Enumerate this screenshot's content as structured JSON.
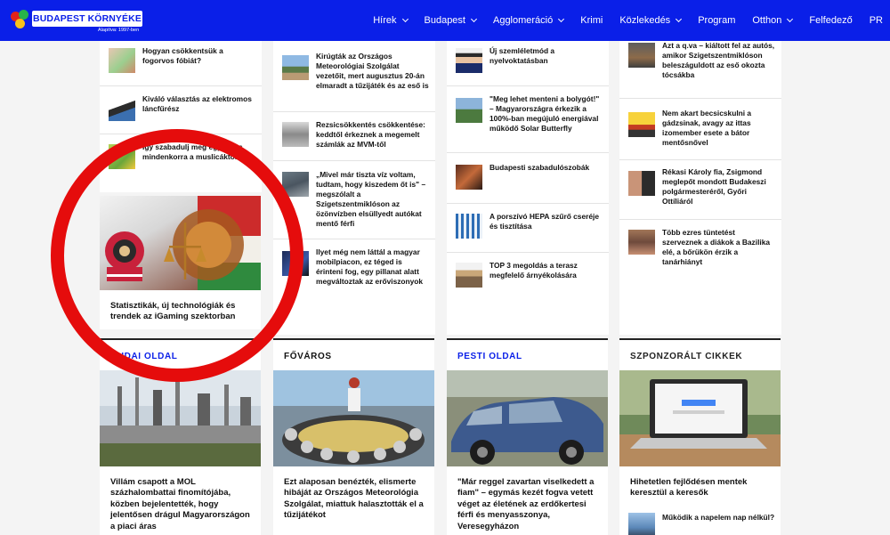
{
  "header": {
    "logo_text": "BUDAPEST KÖRNYÉKE",
    "logo_sub": "Alapítva: 1997-ben",
    "nav": [
      {
        "label": "Hírek",
        "dropdown": true
      },
      {
        "label": "Budapest",
        "dropdown": true
      },
      {
        "label": "Agglomeráció",
        "dropdown": true
      },
      {
        "label": "Krimi",
        "dropdown": false
      },
      {
        "label": "Közlekedés",
        "dropdown": true
      },
      {
        "label": "Program",
        "dropdown": false
      },
      {
        "label": "Otthon",
        "dropdown": true
      },
      {
        "label": "Felfedező",
        "dropdown": false
      },
      {
        "label": "PR",
        "dropdown": false
      }
    ]
  },
  "col1": {
    "items": [
      "Hogyan csökkentsük a fogorvos fóbiát?",
      "Kiváló választás az elektromos láncfűrész",
      "Így szabadulj meg egyszer s mindenkorra a muslicáktól..."
    ],
    "featured_title": "Statisztikák, új technológiák és trendek az iGaming szektorban"
  },
  "col2": {
    "items": [
      "Kirúgták az Országos Meteorológiai Szolgálat vezetőit, mert augusztus 20-án elmaradt a tűzijáték és az eső is",
      "Rezsicsökkentés csökkentése: keddtől érkeznek a megemelt számlák az MVM-től",
      "„Mivel már tiszta víz voltam, tudtam, hogy kiszedem őt is\" – megszólalt a Szigetszentmiklóson az özönvízben elsüllyedt autókat mentő férfi",
      "Ilyet még nem láttál a magyar mobilpiacon, ez téged is érinteni fog, egy pillanat alatt megváltoztak az erőviszonyok"
    ]
  },
  "col3": {
    "items": [
      "Új szemléletmód a nyelvoktatásban",
      "\"Meg lehet menteni a bolygót!\" – Magyarországra érkezik a 100%-ban megújuló energiával működő Solar Butterfly",
      "Budapesti szabadulószobák",
      "A porszívó HEPA szűrő cseréje és tisztítása",
      "TOP 3 megoldás a terasz megfelelő árnyékolására"
    ]
  },
  "col4": {
    "items": [
      "Azt a q.va – kiáltott fel az autós, amikor Szigetszentmiklóson beleszáguldott az eső okozta tócsákba",
      "Nem akart becsicskulni a gádzsinak, avagy az ittas izomember esete a bátor mentősnővel",
      "Rékasi Károly fia, Zsigmond meglepőt mondott Budakeszi polgármesteréről, Győri Ottíliáról",
      "Több ezres tüntetést szerveznek a diákok a Bazilika elé, a bőrükön érzik a tanárhiányt"
    ]
  },
  "sections": [
    {
      "heading": "BUDAI OLDAL",
      "heading_color": "#0a1fe8",
      "title": "Villám csapott a MOL százhalombattai finomítójába, közben bejelentették, hogy jelentősen drágul Magyarországon a piaci áras"
    },
    {
      "heading": "FŐVÁROS",
      "heading_color": "#111111",
      "title": "Ezt alaposan benézték, elismerte hibáját az Országos Meteorológia Szolgálat, miattuk halasztották el a tűzijátékot"
    },
    {
      "heading": "PESTI OLDAL",
      "heading_color": "#0a1fe8",
      "title": "\"Már reggel zavartan viselkedett a fiam\" – egymás kezét fogva vetett véget az életének az erdőkertesi férfi és menyasszonya, Veresegyházon"
    },
    {
      "heading": "SZPONZORÁLT CIKKEK",
      "heading_color": "#222222",
      "title": "Hihetetlen fejlődésen mentek keresztül a keresők"
    }
  ],
  "sponsored_extra": "Működik a napelem nap nélkül?",
  "colors": {
    "brand": "#0a1fe8",
    "highlight_circle": "#e50c0c"
  }
}
